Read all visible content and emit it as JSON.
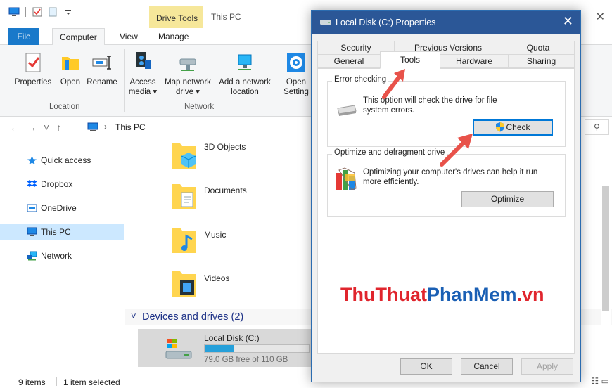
{
  "explorer": {
    "title": "This PC",
    "contextual_tab_group": "Drive Tools",
    "tabs": {
      "file": "File",
      "computer": "Computer",
      "view": "View",
      "manage": "Manage"
    },
    "ribbon": {
      "location_buttons": [
        {
          "label": "Properties"
        },
        {
          "label": "Open"
        },
        {
          "label": "Rename"
        }
      ],
      "location_group": "Location",
      "network_buttons": [
        {
          "label_line1": "Access",
          "label_line2": "media ▾"
        },
        {
          "label_line1": "Map network",
          "label_line2": "drive ▾"
        },
        {
          "label_line1": "Add a network",
          "label_line2": "location"
        }
      ],
      "network_group": "Network",
      "open_settings_line1": "Open",
      "open_settings_line2": "Setting"
    },
    "address": {
      "path": "This PC",
      "separator": "›"
    },
    "nav": {
      "items": [
        {
          "label": "Quick access"
        },
        {
          "label": "Dropbox"
        },
        {
          "label": "OneDrive"
        },
        {
          "label": "This PC"
        },
        {
          "label": "Network"
        }
      ]
    },
    "folders": [
      {
        "name": "3D Objects"
      },
      {
        "name": "Documents"
      },
      {
        "name": "Music"
      },
      {
        "name": "Videos"
      }
    ],
    "devices_section": "Devices and drives (2)",
    "drive": {
      "name": "Local Disk (C:)",
      "free_text": "79.0 GB free of 110 GB",
      "used_fraction": 0.28
    },
    "status": {
      "items": "9 items",
      "selected": "1 item selected"
    }
  },
  "dialog": {
    "title": "Local Disk (C:) Properties",
    "tabs_row1": [
      "Security",
      "Previous Versions",
      "Quota"
    ],
    "tabs_row2": [
      "General",
      "Tools",
      "Hardware",
      "Sharing"
    ],
    "active_tab": "Tools",
    "error_checking": {
      "title": "Error checking",
      "text_line1": "This option will check the drive for file",
      "text_line2": "system errors.",
      "button": "Check"
    },
    "optimize": {
      "title": "Optimize and defragment drive",
      "text_line1": "Optimizing your computer's drives can help it run",
      "text_line2": "more efficiently.",
      "button": "Optimize"
    },
    "footer": {
      "ok": "OK",
      "cancel": "Cancel",
      "apply": "Apply"
    }
  },
  "watermark": {
    "part1": "ThuThuat",
    "part2": "PhanMem",
    "part3": ".vn"
  },
  "colors": {
    "accent": "#1979ca",
    "dialog_title": "#2b5797",
    "selection": "#cce8ff",
    "arrow": "#e8524a"
  }
}
